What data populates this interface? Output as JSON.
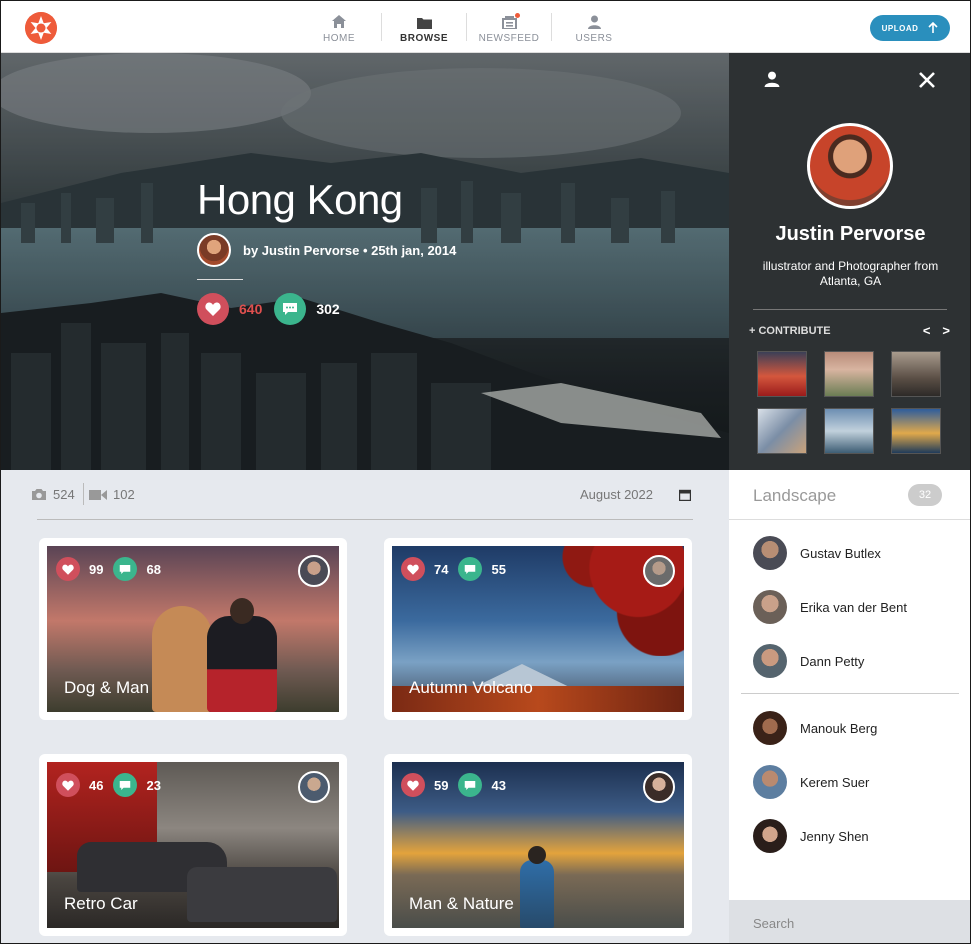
{
  "nav": {
    "items": [
      {
        "label": "HOME",
        "icon": "home-icon"
      },
      {
        "label": "BROWSE",
        "icon": "folder-icon"
      },
      {
        "label": "NEWSFEED",
        "icon": "newsfeed-icon"
      },
      {
        "label": "USERS",
        "icon": "user-icon"
      }
    ],
    "active": "BROWSE",
    "upload_label": "UPLOAD"
  },
  "hero": {
    "title": "Hong Kong",
    "byline": "by Justin Pervorse • 25th jan, 2014",
    "likes": "640",
    "comments": "302"
  },
  "profile": {
    "name": "Justin Pervorse",
    "bio": "illustrator and Photographer from Atlanta, GA",
    "contribute_label": "+ CONTRIBUTE",
    "prev": "<",
    "next": ">"
  },
  "toolbar": {
    "photos": "524",
    "videos": "102",
    "date": "August 2022"
  },
  "cards": [
    {
      "title": "Dog & Man",
      "likes": "99",
      "comments": "68"
    },
    {
      "title": "Autumn Volcano",
      "likes": "74",
      "comments": "55"
    },
    {
      "title": "Retro Car",
      "likes": "46",
      "comments": "23"
    },
    {
      "title": "Man & Nature",
      "likes": "59",
      "comments": "43"
    }
  ],
  "sidebar": {
    "category": "Landscape",
    "count": "32",
    "users": [
      "Gustav Butlex",
      "Erika van der Bent",
      "Dann Petty",
      "Manouk Berg",
      "Kerem Suer",
      "Jenny Shen"
    ],
    "search_placeholder": "Search"
  },
  "colors": {
    "accent": "#ee5b3a",
    "upload": "#2a8fbd",
    "like": "#d04f5c",
    "comment": "#3bb58d"
  }
}
